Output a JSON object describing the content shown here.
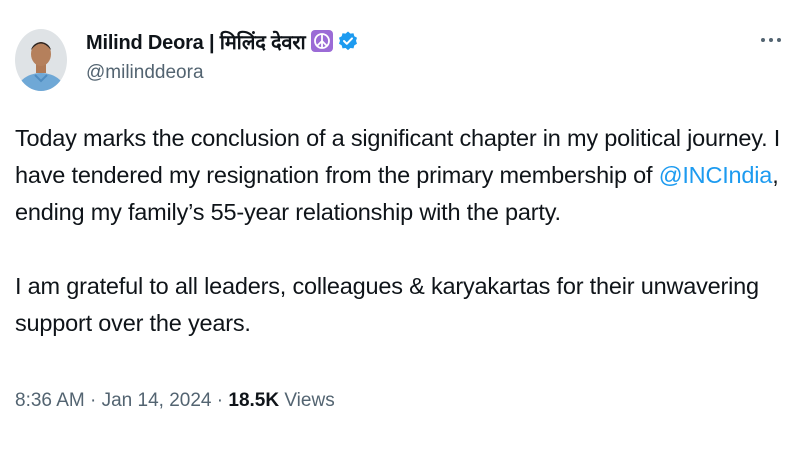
{
  "author": {
    "display_name": "Milind Deora | मिलिंद देवरा",
    "handle": "@milinddeora",
    "avatar_icon": "profile-photo",
    "badges": [
      "peace-symbol-icon",
      "verified-icon"
    ],
    "verified_color": "#1d9bf0",
    "peace_badge_color": "#9b6bd6"
  },
  "menu": {
    "more_icon": "more-horizontal-icon"
  },
  "tweet": {
    "paragraph1_before": "Today marks the conclusion of a significant chapter in my political journey. I have tendered my resignation from the primary membership of ",
    "mention": "@INCIndia",
    "paragraph1_after": ", ending my family’s 55-year relationship with the party.",
    "paragraph2": "I am grateful to all leaders, colleagues & karyakartas for their unwavering support over the years."
  },
  "meta": {
    "time": "8:36 AM",
    "separator": " · ",
    "date": "Jan 14, 2024",
    "views_count": "18.5K",
    "views_label": " Views"
  },
  "colors": {
    "text_primary": "#0f1419",
    "text_secondary": "#536471",
    "link": "#1d9bf0"
  }
}
